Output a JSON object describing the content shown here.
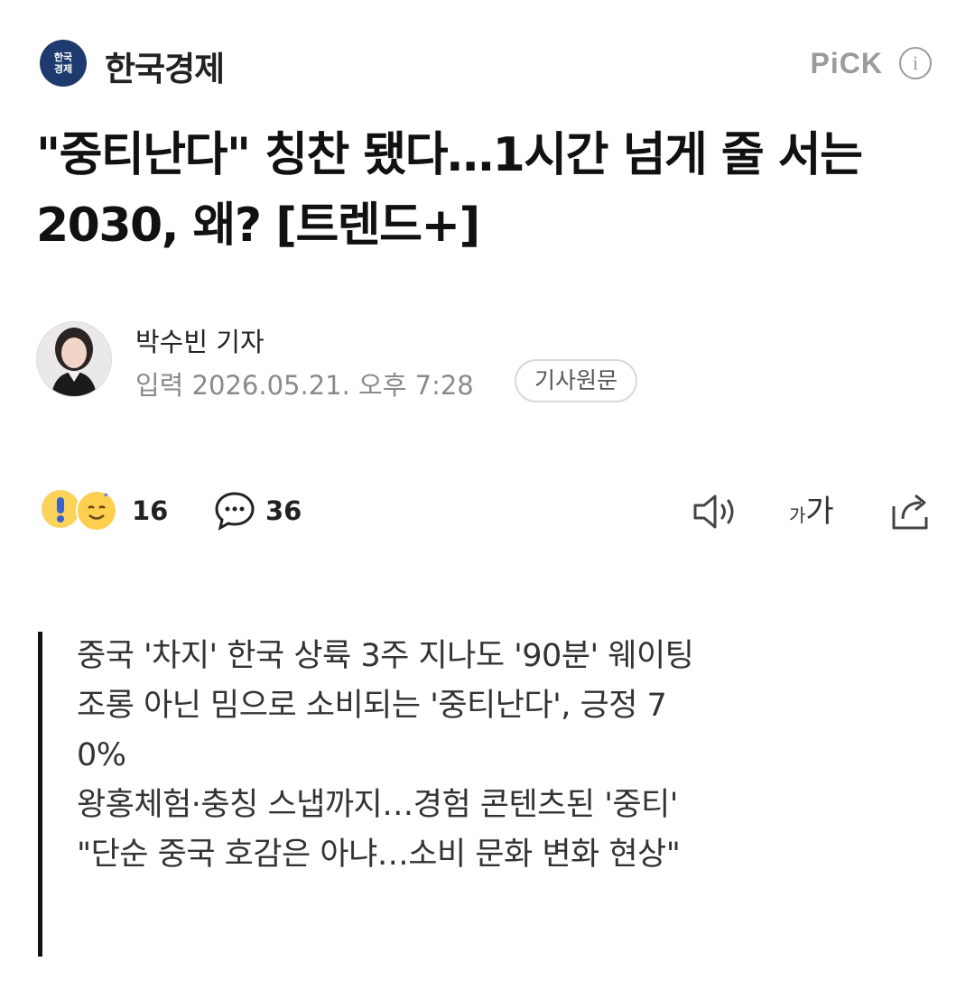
{
  "header": {
    "press_logo_text": "한국\n경제",
    "press_name": "한국경제",
    "pick_label": "PiCK",
    "info_icon": "info-icon"
  },
  "article": {
    "title": "\"중티난다\" 칭찬 됐다…1시간 넘게 줄 서는 2030, 왜? [트렌드+]",
    "reporter": "박수빈 기자",
    "date": "입력 2026.05.21. 오후 7:28",
    "original_button": "기사원문"
  },
  "actions": {
    "reaction_count": "16",
    "comment_count": "36",
    "icons": [
      "reaction-emoji-icon",
      "comment-icon",
      "tts-speaker-icon",
      "font-size-icon",
      "share-icon"
    ],
    "font_small": "가",
    "font_large": "가"
  },
  "summary": {
    "lines": [
      "중국 '차지' 한국 상륙 3주 지나도 '90분' 웨이팅",
      "조롱 아닌 밈으로 소비되는 '중티난다', 긍정 7",
      "0%",
      "왕홍체험·충칭 스냅까지…경험 콘텐츠된 '중티'",
      "\"단순 중국 호감은 아냐…소비 문화 변화 현상\""
    ]
  },
  "colors": {
    "press_logo_bg": "#1f3a6e",
    "muted_gray": "#9b9b9b",
    "summary_bar": "#111111",
    "emoji_yellow": "#fbd25a"
  }
}
